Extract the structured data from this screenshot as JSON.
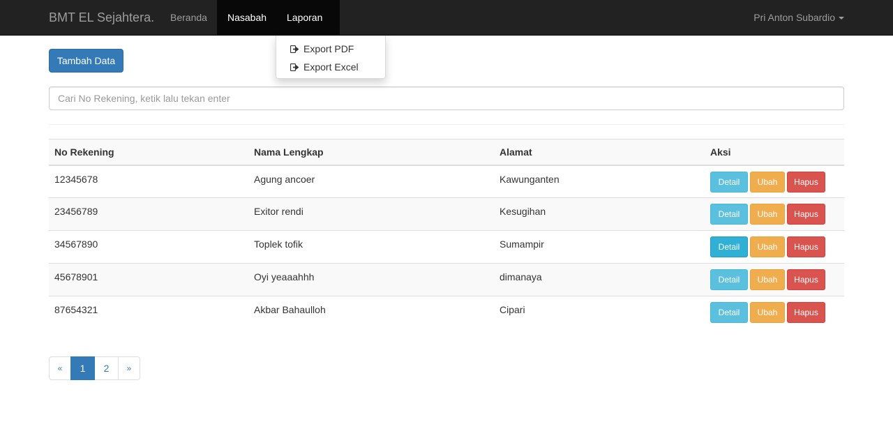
{
  "navbar": {
    "brand": "BMT EL Sejahtera.",
    "items": [
      {
        "label": "Beranda"
      },
      {
        "label": "Nasabah"
      },
      {
        "label": "Laporan"
      }
    ],
    "user": "Pri Anton Subardio"
  },
  "dropdown": {
    "items": [
      {
        "label": "Export PDF",
        "icon": "export-icon"
      },
      {
        "label": "Export Excel",
        "icon": "export-icon"
      }
    ]
  },
  "actions": {
    "add_label": "Tambah Data"
  },
  "search": {
    "placeholder": "Cari No Rekening, ketik lalu tekan enter"
  },
  "table": {
    "headers": [
      "No Rekening",
      "Nama Lengkap",
      "Alamat",
      "Aksi"
    ],
    "rows": [
      {
        "no_rekening": "12345678",
        "nama": "Agung ancoer",
        "alamat": "Kawunganten"
      },
      {
        "no_rekening": "23456789",
        "nama": "Exitor rendi",
        "alamat": "Kesugihan"
      },
      {
        "no_rekening": "34567890",
        "nama": "Toplek tofik",
        "alamat": "Sumampir"
      },
      {
        "no_rekening": "45678901",
        "nama": "Oyi yeaaahhh",
        "alamat": "dimanaya"
      },
      {
        "no_rekening": "87654321",
        "nama": "Akbar Bahaulloh",
        "alamat": "Cipari"
      }
    ],
    "buttons": {
      "detail": "Detail",
      "ubah": "Ubah",
      "hapus": "Hapus"
    }
  },
  "pagination": {
    "prev": "«",
    "pages": [
      "1",
      "2"
    ],
    "next": "»",
    "current": "1"
  },
  "colors": {
    "primary": "#337ab7",
    "info": "#5bc0de",
    "warning": "#f0ad4e",
    "danger": "#d9534f",
    "navbar": "#222222"
  }
}
